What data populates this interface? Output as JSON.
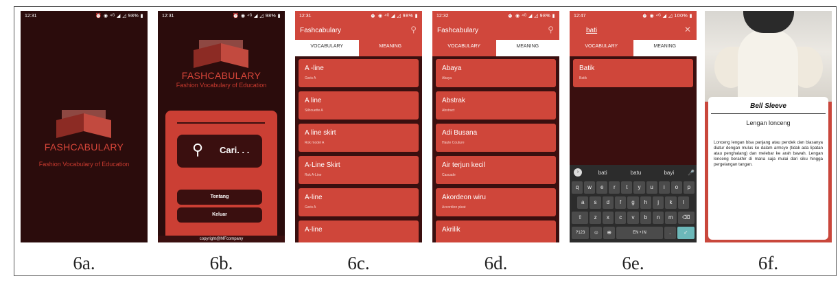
{
  "captions": [
    "6a.",
    "6b.",
    "6c.",
    "6d.",
    "6e.",
    "6f."
  ],
  "status_bars": [
    {
      "time": "12:31",
      "right": "⏰ ◉ ⁴ᴳ ◢ ◿ 98% ▮"
    },
    {
      "time": "12:31",
      "right": "⏰ ◉ ⁴ᴳ ◢ ◿ 98% ▮"
    },
    {
      "time": "12:31",
      "right": "⏰ ◉ ⁴ᴳ ◢ ◿ 98% ▮"
    },
    {
      "time": "12:32",
      "right": "⏰ ◉ ⁴ᴳ ◢ ◿ 98% ▮"
    },
    {
      "time": "12:47",
      "right": "⏰ ◉ ⁴ᴳ ◢ ◿ 100% ▮"
    },
    {
      "time": "",
      "right": ""
    }
  ],
  "splash": {
    "brand": "FASHCABULARY",
    "tagline": "Fashion Vocabulary of Education"
  },
  "menu": {
    "brand": "FASHCABULARY",
    "tagline": "Fashion Vocabulary of Education",
    "search_label": "Cari. . .",
    "about_label": "Tentang",
    "exit_label": "Keluar",
    "copyright": "copyright@MFcompany"
  },
  "app": {
    "title": "Fashcabulary",
    "tab_vocab": "VOCABULARY",
    "tab_meaning": "MEANING"
  },
  "vocab_list": [
    {
      "term": "A -line",
      "meaning": "Garis A"
    },
    {
      "term": "A line",
      "meaning": "Silhouette A"
    },
    {
      "term": "A line skirt",
      "meaning": "Rok model A"
    },
    {
      "term": "A-Line Skirt",
      "meaning": "Rok A-Line"
    },
    {
      "term": "A-line",
      "meaning": "Garis A"
    },
    {
      "term": "A-line",
      "meaning": ""
    }
  ],
  "meaning_list": [
    {
      "term": "Abaya",
      "meaning": "Abaya"
    },
    {
      "term": "Abstrak",
      "meaning": "Abstract"
    },
    {
      "term": "Adi Busana",
      "meaning": "Haute Couture"
    },
    {
      "term": "Air terjun kecil",
      "meaning": "Cascade"
    },
    {
      "term": "Akordeon wiru",
      "meaning": "Accordion pleat"
    },
    {
      "term": "Akrilik",
      "meaning": ""
    }
  ],
  "search": {
    "query": "bati",
    "result_term": "Batik",
    "result_meaning": "Batik",
    "suggestions": [
      "bati",
      "batu",
      "bayi"
    ],
    "row1": [
      "q",
      "w",
      "e",
      "r",
      "t",
      "y",
      "u",
      "i",
      "o",
      "p"
    ],
    "row2": [
      "a",
      "s",
      "d",
      "f",
      "g",
      "h",
      "j",
      "k",
      "l"
    ],
    "row3": [
      "⇧",
      "z",
      "x",
      "c",
      "v",
      "b",
      "n",
      "m",
      "⌫"
    ],
    "row4": [
      "?123",
      "☺",
      "⊕",
      "EN • IN",
      ".",
      "✓"
    ]
  },
  "detail": {
    "title": "Bell Sleeve",
    "translation": "Lengan lonceng",
    "description": "Lonceng lengan bisa panjang atau pendek dan biasanya diatur dengan mulus ke dalam armcye (tidak ada lipatan atau penghalang) dan melebar ke arah bawah. Lengan lonceng berakhir di mana saja mulai dari siku hingga pergelangan tangan."
  },
  "colors": {
    "accent": "#d0473c",
    "dark_bg": "#2b0c0c",
    "card": "#cf463a"
  }
}
